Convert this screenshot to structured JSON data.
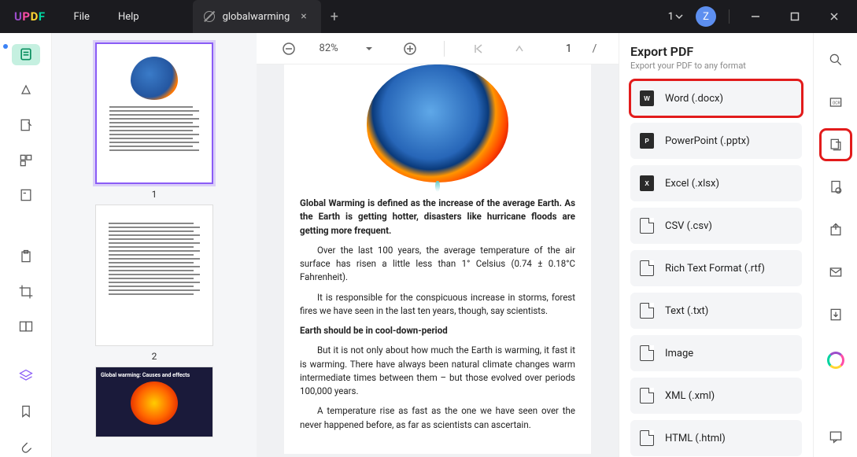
{
  "app": {
    "logo_chars": [
      "U",
      "P",
      "D",
      "F"
    ]
  },
  "menu": {
    "file": "File",
    "help": "Help"
  },
  "tab": {
    "title": "globalwarming"
  },
  "titlebar": {
    "count": "1",
    "avatar_initial": "Z"
  },
  "toolbar": {
    "zoom": "82%",
    "page_current": "1",
    "page_sep": "/"
  },
  "thumbnails": {
    "p1": "1",
    "p2": "2"
  },
  "document": {
    "para1": "Global Warming is defined as the increase of the average Earth. As the Earth is getting hotter, disasters like hurricane floods are getting more frequent.",
    "para2": "Over the last 100 years, the average temperature of the air surface has risen a little less than 1° Celsius (0.74 ± 0.18°C Fahrenheit).",
    "para3": "It is responsible for the conspicuous increase in storms, forest fires we have seen in the last ten years, though, say scientists.",
    "heading": "Earth should be in cool-down-period",
    "para4": "But it is not only about how much the Earth is warming, it fast it is warming. There have always been natural climate changes warm intermediate times between them – but those evolved over periods 100,000 years.",
    "para5": "A temperature rise as fast as the one we have seen over the never happened before, as far as scientists can ascertain."
  },
  "export": {
    "title": "Export PDF",
    "subtitle": "Export your PDF to any format",
    "items": [
      {
        "label": "Word (.docx)",
        "badge": "W"
      },
      {
        "label": "PowerPoint (.pptx)",
        "badge": "P"
      },
      {
        "label": "Excel (.xlsx)",
        "badge": "X"
      },
      {
        "label": "CSV (.csv)",
        "badge": ""
      },
      {
        "label": "Rich Text Format (.rtf)",
        "badge": ""
      },
      {
        "label": "Text (.txt)",
        "badge": ""
      },
      {
        "label": "Image",
        "badge": ""
      },
      {
        "label": "XML (.xml)",
        "badge": ""
      },
      {
        "label": "HTML (.html)",
        "badge": ""
      }
    ]
  },
  "thumb3": {
    "caption": "Global warming: Causes and effects"
  }
}
